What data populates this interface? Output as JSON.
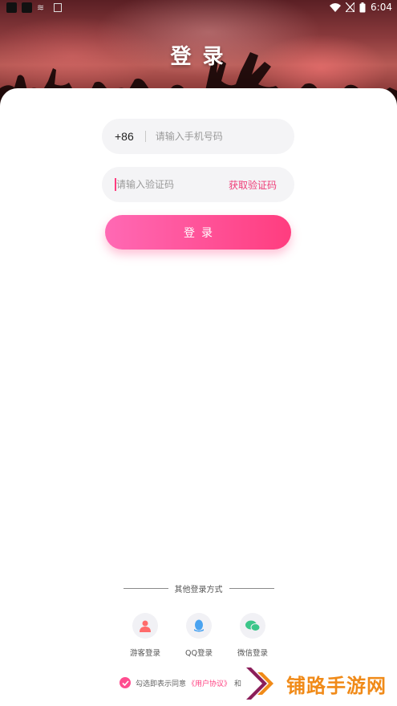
{
  "status_bar": {
    "time": "6:04"
  },
  "header": {
    "title": "登录"
  },
  "form": {
    "country_code": "+86",
    "phone_placeholder": "请输入手机号码",
    "code_placeholder": "请输入验证码",
    "get_code_label": "获取验证码",
    "login_label": "登录"
  },
  "other_login": {
    "label": "其他登录方式",
    "methods": [
      {
        "label": "游客登录",
        "icon": "guest-icon",
        "color": "#ff6b6b"
      },
      {
        "label": "QQ登录",
        "icon": "qq-icon",
        "color": "#4aa3f0"
      },
      {
        "label": "微信登录",
        "icon": "wechat-icon",
        "color": "#3cc68a"
      }
    ]
  },
  "agreement": {
    "text": "勾选即表示同意",
    "link": "《用户协议》",
    "and": "和"
  },
  "watermark": {
    "text": "铺路手游网"
  },
  "colors": {
    "accent": "#ff3d7f",
    "accent_light": "#ff69b4",
    "watermark": "#f08a18"
  }
}
